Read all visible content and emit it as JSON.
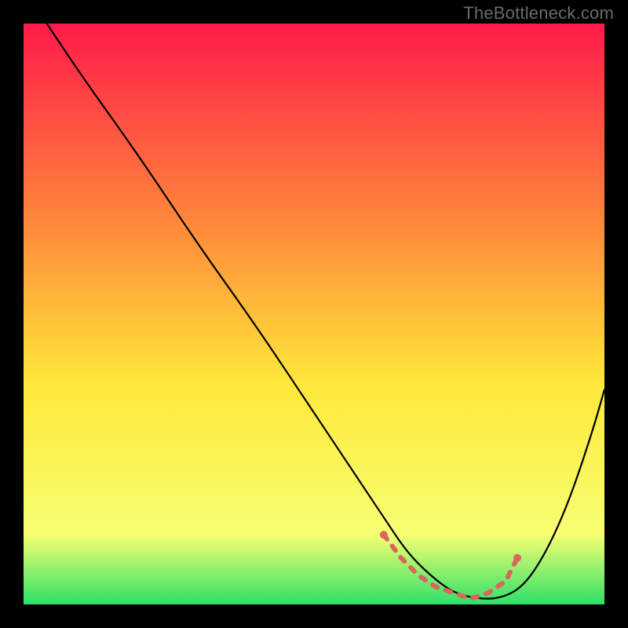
{
  "attribution": "TheBottleneck.com",
  "colors": {
    "background": "#000000",
    "attribution_text": "#6a6a6a",
    "curve": "#000000",
    "marker": "#d9655b",
    "gradient_top": "#ff1a4a",
    "gradient_mid_upper": "#ff8a3a",
    "gradient_mid": "#ffe83a",
    "gradient_lower": "#f6ff73",
    "gradient_bottom": "#2fe06a"
  },
  "chart_data": {
    "type": "line",
    "title": "",
    "xlabel": "",
    "ylabel": "",
    "xlim": [
      0,
      100
    ],
    "ylim": [
      0,
      100
    ],
    "background_gradient": {
      "direction": "vertical",
      "stops": [
        {
          "pos": 0,
          "color": "#ff1a4a"
        },
        {
          "pos": 35,
          "color": "#ff8a3a"
        },
        {
          "pos": 62,
          "color": "#ffe83a"
        },
        {
          "pos": 88,
          "color": "#f6ff73"
        },
        {
          "pos": 100,
          "color": "#2fe06a"
        }
      ]
    },
    "series": [
      {
        "name": "bottleneck-curve",
        "x": [
          4,
          10,
          20,
          30,
          40,
          50,
          58,
          62,
          66,
          70,
          74,
          78,
          82,
          86,
          90,
          94,
          98,
          100
        ],
        "y": [
          100,
          91,
          77,
          62,
          48,
          33,
          21,
          15,
          9,
          5,
          2,
          1,
          1,
          3,
          9,
          18,
          30,
          37
        ]
      }
    ],
    "markers": {
      "name": "optimal-range",
      "x": [
        62,
        65,
        68,
        71,
        74,
        77,
        80,
        83,
        85
      ],
      "y": [
        12,
        8,
        5,
        3,
        2,
        1,
        2,
        4,
        8
      ]
    }
  }
}
